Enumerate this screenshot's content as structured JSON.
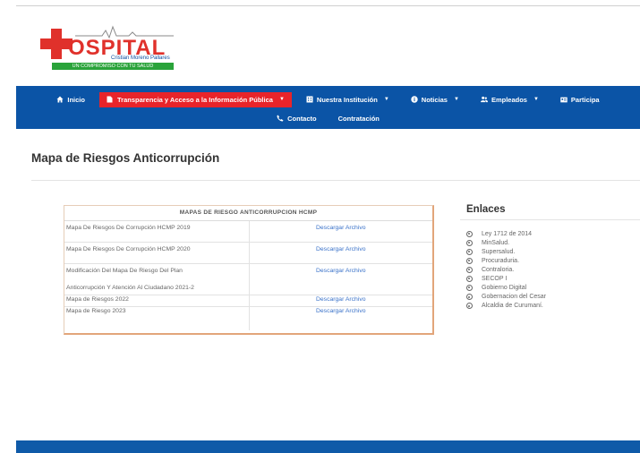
{
  "logo": {
    "name": "OSPITAL",
    "subtitle": "Cristian Moreno Pallares",
    "slogan": "UN COMPROMISO CON TU SALUD"
  },
  "nav": {
    "row1": [
      {
        "label": "Inicio",
        "icon": "home-icon",
        "dropdown": false,
        "active": false
      },
      {
        "label": "Transparencia y Acceso a la Información Pública",
        "icon": "document-icon",
        "dropdown": true,
        "active": true
      },
      {
        "label": "Nuestra Institución",
        "icon": "building-icon",
        "dropdown": true,
        "active": false
      },
      {
        "label": "Noticias",
        "icon": "info-icon",
        "dropdown": true,
        "active": false
      },
      {
        "label": "Empleados",
        "icon": "users-icon",
        "dropdown": true,
        "active": false
      },
      {
        "label": "Participa",
        "icon": "id-card-icon",
        "dropdown": false,
        "active": false
      }
    ],
    "row2": [
      {
        "label": "Contacto",
        "icon": "phone-icon",
        "dropdown": false,
        "active": false
      },
      {
        "label": "Contratación",
        "icon": "",
        "dropdown": false,
        "active": false
      }
    ]
  },
  "page": {
    "title": "Mapa de Riesgos Anticorrupción"
  },
  "table": {
    "header": "MAPAS DE RIESGO ANTICORRUPCION HCMP",
    "rows": [
      {
        "name": "Mapa De Riesgos De Corrupción HCMP 2019",
        "link": "Descargar Archivo"
      },
      {
        "name": "Mapa De Riesgos De Corrupción HCMP 2020",
        "link": "Descargar Archivo"
      },
      {
        "name": "Modificación Del Mapa De Riesgo Del Plan",
        "name_line2": "Anticorrupción Y Atención Al Ciudadano 2021-2",
        "link": "Descargar Archivo"
      },
      {
        "name": "Mapa de Riesgos 2022",
        "link": "Descargar Archivo"
      },
      {
        "name": "Mapa de Riesgo 2023",
        "link": "Descargar Archivo"
      }
    ]
  },
  "links": {
    "title": "Enlaces",
    "items": [
      "Ley 1712 de 2014",
      "MinSalud.",
      "Supersalud.",
      "Procuraduria.",
      "Contraloria.",
      "SECOP I",
      "Gobierno Digital",
      "Gobernacion del Cesar",
      "Alcaldia de Curumaní."
    ]
  },
  "colors": {
    "nav_bg": "#0b54a6",
    "active_bg": "#e8242a",
    "link": "#3a72c9",
    "logo_red": "#e0312b",
    "logo_green": "#2aa33a"
  }
}
